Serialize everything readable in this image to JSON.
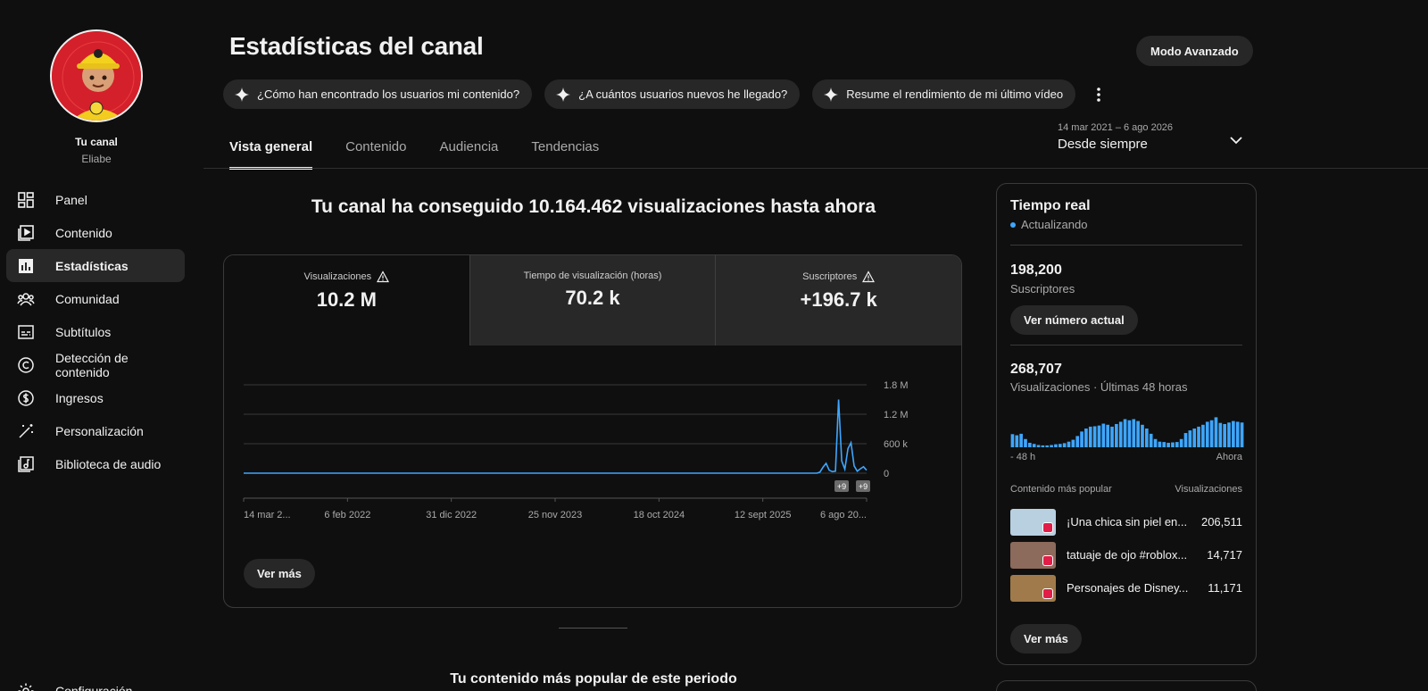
{
  "sidebar": {
    "channel_title": "Tu canal",
    "channel_name": "Eliabe",
    "items": [
      {
        "label": "Panel",
        "icon": "dashboard-icon"
      },
      {
        "label": "Contenido",
        "icon": "content-icon"
      },
      {
        "label": "Estadísticas",
        "icon": "analytics-icon",
        "active": true
      },
      {
        "label": "Comunidad",
        "icon": "community-icon"
      },
      {
        "label": "Subtítulos",
        "icon": "subtitles-icon"
      },
      {
        "label": "Detección de contenido",
        "icon": "copyright-icon"
      },
      {
        "label": "Ingresos",
        "icon": "dollar-icon"
      },
      {
        "label": "Personalización",
        "icon": "magic-wand-icon"
      },
      {
        "label": "Biblioteca de audio",
        "icon": "audio-library-icon"
      }
    ],
    "settings_label": "Configuración"
  },
  "header": {
    "title": "Estadísticas del canal",
    "advanced_mode": "Modo Avanzado",
    "chips": [
      "¿Cómo han encontrado los usuarios mi contenido?",
      "¿A cuántos usuarios nuevos he llegado?",
      "Resume el rendimiento de mi último vídeo"
    ],
    "tabs": [
      "Vista general",
      "Contenido",
      "Audiencia",
      "Tendencias"
    ],
    "active_tab": "Vista general",
    "date_range": {
      "dates": "14 mar 2021 – 6 ago 2026",
      "label": "Desde siempre"
    }
  },
  "main": {
    "headline": "Tu canal ha conseguido 10.164.462 visualizaciones hasta ahora",
    "metrics": [
      {
        "label": "Visualizaciones",
        "value": "10.2 M",
        "warning": true
      },
      {
        "label": "Tiempo de visualización (horas)",
        "value": "70.2 k",
        "warning": false
      },
      {
        "label": "Suscriptores",
        "value": "+196.7 k",
        "warning": true
      }
    ],
    "see_more": "Ver más",
    "popular_section_title": "Tu contenido más popular de este periodo"
  },
  "chart_data": {
    "type": "line",
    "series": [
      {
        "values": [
          0,
          0,
          0,
          0,
          0,
          0,
          0,
          0,
          0,
          0,
          0,
          0,
          0,
          0,
          0,
          0,
          0,
          0,
          0,
          0,
          0,
          0,
          0,
          0,
          0,
          0,
          0,
          0,
          0,
          0,
          0,
          0,
          0,
          0,
          0,
          0,
          0,
          0,
          0,
          0,
          0,
          0,
          0,
          0,
          0,
          0,
          0,
          0,
          0,
          0,
          0,
          0,
          0,
          0,
          0,
          0,
          0,
          0,
          0,
          0,
          0,
          0,
          0,
          0,
          0,
          0,
          0,
          0,
          0,
          0,
          0,
          0,
          0,
          0,
          0,
          0,
          0,
          0,
          0,
          0,
          0,
          0,
          0,
          0,
          0,
          0,
          0,
          0,
          0,
          0,
          0,
          0,
          0,
          0,
          0,
          0,
          0,
          0,
          0,
          0,
          0,
          0,
          0,
          0,
          0,
          0,
          0,
          0,
          0,
          0,
          0,
          0,
          0,
          0,
          0,
          0,
          0,
          0,
          0,
          0,
          0,
          0,
          0,
          0,
          0,
          0,
          0,
          0,
          0,
          0,
          0,
          0,
          0,
          0,
          0,
          0,
          0,
          0,
          0,
          0,
          0,
          0,
          0,
          0,
          0,
          0,
          0,
          0,
          0,
          0,
          0,
          0,
          0,
          0,
          0,
          0,
          0,
          0,
          0,
          0,
          0,
          0,
          0,
          0,
          0,
          0,
          0,
          0,
          0,
          0,
          0,
          0,
          0,
          0,
          0,
          0,
          0,
          0,
          0,
          0,
          0,
          0,
          0,
          0,
          0,
          20000,
          120000,
          200000,
          60000,
          30000,
          40000,
          1500000,
          250000,
          80000,
          500000,
          620000,
          150000,
          40000,
          90000,
          130000,
          60000
        ]
      }
    ],
    "x_tick_labels": [
      "14 mar 2...",
      "6 feb 2022",
      "31 dic 2022",
      "25 nov 2023",
      "18 oct 2024",
      "12 sept 2025",
      "6 ago 20..."
    ],
    "y_tick_labels": [
      "1.8 M",
      "1.2 M",
      "600 k",
      "0"
    ],
    "ylim": [
      0,
      1800000
    ],
    "markers": [
      "+9",
      "+9"
    ],
    "color": "#3ea6ff",
    "grid": true
  },
  "realtime": {
    "title": "Tiempo real",
    "status": "Actualizando",
    "subscribers": "198,200",
    "subscribers_label": "Suscriptores",
    "see_current": "Ver número actual",
    "views": "268,707",
    "views_label": "Visualizaciones · Últimas 48 horas",
    "bars": [
      0.35,
      0.32,
      0.36,
      0.22,
      0.12,
      0.09,
      0.06,
      0.05,
      0.05,
      0.06,
      0.08,
      0.09,
      0.11,
      0.15,
      0.2,
      0.3,
      0.42,
      0.5,
      0.55,
      0.56,
      0.58,
      0.63,
      0.6,
      0.55,
      0.62,
      0.68,
      0.75,
      0.72,
      0.75,
      0.7,
      0.6,
      0.5,
      0.36,
      0.22,
      0.15,
      0.14,
      0.12,
      0.13,
      0.14,
      0.22,
      0.38,
      0.45,
      0.5,
      0.55,
      0.6,
      0.68,
      0.72,
      0.8,
      0.65,
      0.62,
      0.66,
      0.7,
      0.68,
      0.66
    ],
    "bar_color": "#3ea6ff",
    "axis_start": "- 48 h",
    "axis_end": "Ahora",
    "col_content": "Contenido más popular",
    "col_views": "Visualizaciones",
    "top_content": [
      {
        "title": "¡Una chica sin piel en...",
        "views": "206,511",
        "thumb": "#b8d0e0"
      },
      {
        "title": "tatuaje de ojo #roblox...",
        "views": "14,717",
        "thumb": "#8c6a5c"
      },
      {
        "title": "Personajes de Disney...",
        "views": "11,171",
        "thumb": "#a07a4a"
      }
    ],
    "see_more": "Ver más"
  }
}
